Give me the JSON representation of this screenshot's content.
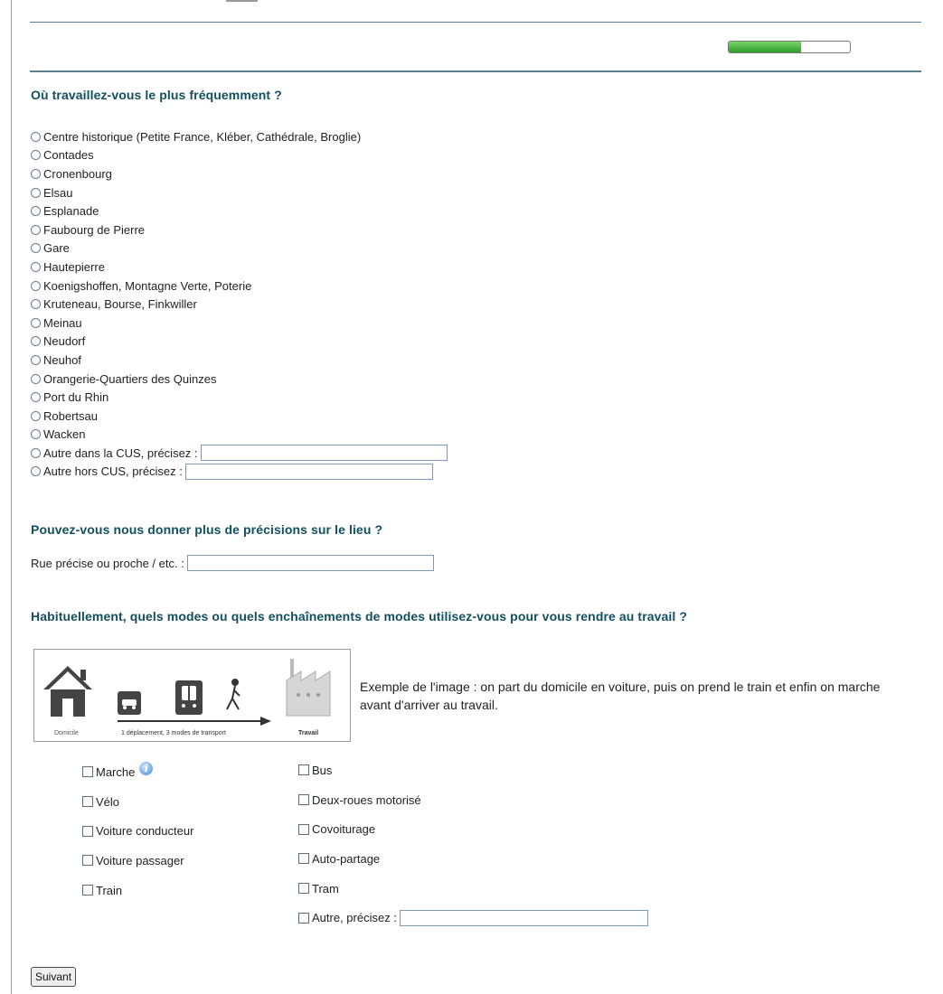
{
  "progress": {
    "value": 0.6
  },
  "q1": {
    "title": "Où travaillez-vous le plus fréquemment ?",
    "options": [
      "Centre historique (Petite France, Kléber, Cathédrale, Broglie)",
      "Contades",
      "Cronenbourg",
      "Elsau",
      "Esplanade",
      "Faubourg de Pierre",
      "Gare",
      "Hautepierre",
      "Koenigshoffen, Montagne Verte, Poterie",
      "Kruteneau, Bourse, Finkwiller",
      "Meinau",
      "Neudorf",
      "Neuhof",
      "Orangerie-Quartiers des Quinzes",
      "Port du Rhin",
      "Robertsau",
      "Wacken",
      "Autre dans la CUS, précisez :",
      "Autre hors CUS, précisez :"
    ]
  },
  "q2": {
    "title": "Pouvez-vous nous donner plus de précisions sur le lieu ?",
    "label": "Rue précise ou proche / etc. :"
  },
  "q3": {
    "title": "Habituellement, quels modes ou quels enchaînements de modes utilisez-vous pour vous rendre au travail ?",
    "example_text": "Exemple de l'image : on part du domicile en voiture, puis on prend le train et enfin on marche avant d'arriver au travail.",
    "image_labels": {
      "home": "Domicile",
      "trip": "1 déplacement, 3 modes de transport",
      "work": "Travail"
    },
    "col1": [
      "Marche",
      "Vélo",
      "Voiture conducteur",
      "Voiture passager",
      "Train"
    ],
    "col2": [
      "Bus",
      "Deux-roues motorisé",
      "Covoiturage",
      "Auto-partage",
      "Tram",
      "Autre, précisez :"
    ]
  },
  "buttons": {
    "next": "Suivant"
  }
}
